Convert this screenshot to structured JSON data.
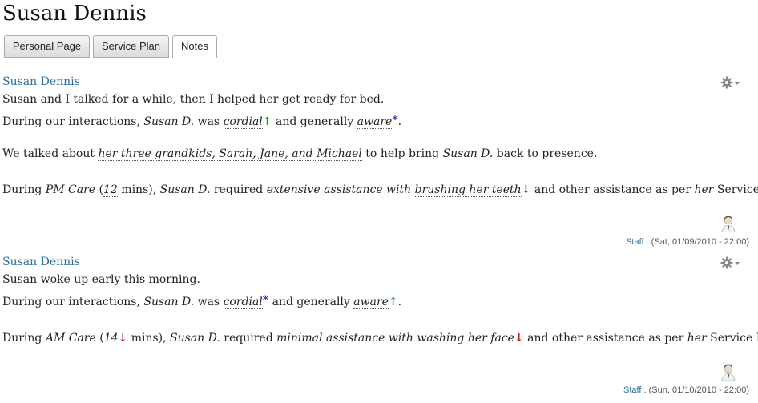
{
  "page_title": "Susan Dennis",
  "tabs": [
    {
      "label": "Personal Page"
    },
    {
      "label": "Service Plan"
    },
    {
      "label": "Notes",
      "active": true
    }
  ],
  "icons": {
    "gear": "gear-icon",
    "dropdown": "chevron-down-icon",
    "avatar": "user-avatar-icon"
  },
  "colors": {
    "link": "#2a6f9e",
    "up_arrow": "#1ca11c",
    "down_arrow": "#cc1111",
    "star": "#1a33cc"
  },
  "notes": [
    {
      "author": "Susan Dennis",
      "intro": "Susan and I talked for a while, then I helped her get ready for bed.",
      "interaction": {
        "prefix": "During our interactions, ",
        "subject": "Susan D.",
        "was": " was ",
        "trait1": "cordial",
        "trait1_mark": "↑",
        "and_generally": " and generally ",
        "trait2": "aware",
        "trait2_mark": "*",
        "end": "."
      },
      "topic": {
        "prefix": "We talked about ",
        "subject_text": "her three grandkids, Sarah, Jane, and Michael",
        "middle": " to help bring ",
        "subject": "Susan D.",
        "end": " back to presence."
      },
      "care": {
        "prefix": "During ",
        "care_type": "PM Care",
        "open": " (",
        "minutes": "12",
        "minutes_mark": "",
        "close": " mins), ",
        "subject": "Susan D.",
        "required": " required ",
        "assistance": "extensive assistance with",
        "space": " ",
        "task": "brushing her teeth",
        "task_mark": "↓",
        "rest": " and other assistance as per ",
        "her": "her",
        "plan": " Service Plan."
      },
      "staff_label": "Staff",
      "timestamp": " . (Sat, 01/09/2010 - 22:00)"
    },
    {
      "author": "Susan Dennis",
      "intro": "Susan woke up early this morning.",
      "interaction": {
        "prefix": "During our interactions, ",
        "subject": "Susan D.",
        "was": " was ",
        "trait1": "cordial",
        "trait1_mark": "*",
        "and_generally": " and generally ",
        "trait2": "aware",
        "trait2_mark": "↑",
        "end": "."
      },
      "care": {
        "prefix": "During ",
        "care_type": "AM Care",
        "open": " (",
        "minutes": "14",
        "minutes_mark": "↓",
        "close": " mins), ",
        "subject": "Susan D.",
        "required": " required ",
        "assistance": "minimal assistance with",
        "space": " ",
        "task": "washing her face",
        "task_mark": "↓",
        "rest": " and other assistance as per ",
        "her": "her",
        "plan": " Service Plan."
      },
      "staff_label": "Staff",
      "timestamp": " . (Sun, 01/10/2010 - 22:00)"
    }
  ]
}
